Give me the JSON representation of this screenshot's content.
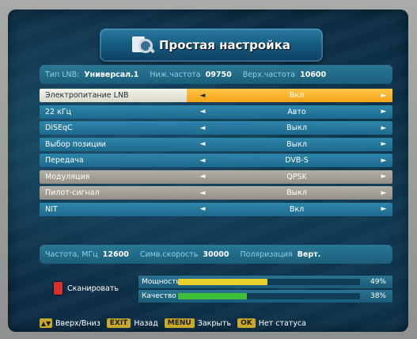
{
  "title": "Простая настройка",
  "lnb_info": {
    "type_label": "Тип LNB:",
    "type_value": "Универсал.1",
    "low_label": "Ниж.частота",
    "low_value": "09750",
    "high_label": "Верх.частота",
    "high_value": "10600"
  },
  "menu": [
    {
      "label": "Электропитание LNB",
      "value": "Вкл",
      "style": "sel"
    },
    {
      "label": "22 кГц",
      "value": "Авто",
      "style": "norm"
    },
    {
      "label": "DiSEqC",
      "value": "Выкл",
      "style": "norm"
    },
    {
      "label": "Выбор позиции",
      "value": "Выкл",
      "style": "norm"
    },
    {
      "label": "Передача",
      "value": "DVB-S",
      "style": "norm"
    },
    {
      "label": "Модуляция",
      "value": "QPSK",
      "style": "grey"
    },
    {
      "label": "Пилот-сигнал",
      "value": "Выкл",
      "style": "grey"
    },
    {
      "label": "NIT",
      "value": "Вкл",
      "style": "norm"
    }
  ],
  "arrows": {
    "left": "◄",
    "right": "►"
  },
  "tp_info": {
    "freq_label": "Частота, МГц",
    "freq_value": "12600",
    "sr_label": "Симв.скорость",
    "sr_value": "30000",
    "pol_label": "Поляризация",
    "pol_value": "Верт."
  },
  "scan": {
    "label": "Сканировать"
  },
  "meters": {
    "power": {
      "label": "Мощность",
      "percent_text": "49%",
      "level": 0.49,
      "color": "#e8d12a"
    },
    "quality": {
      "label": "Качество",
      "percent_text": "38%",
      "level": 0.38,
      "color": "#3fbf3c"
    }
  },
  "footer": {
    "updown_label": "Вверх/Вниз",
    "exit_key": "EXIT",
    "exit_label": "Назад",
    "menu_key": "MENU",
    "menu_label": "Закрыть",
    "ok_key": "OK",
    "ok_label": "Нет статуса"
  }
}
